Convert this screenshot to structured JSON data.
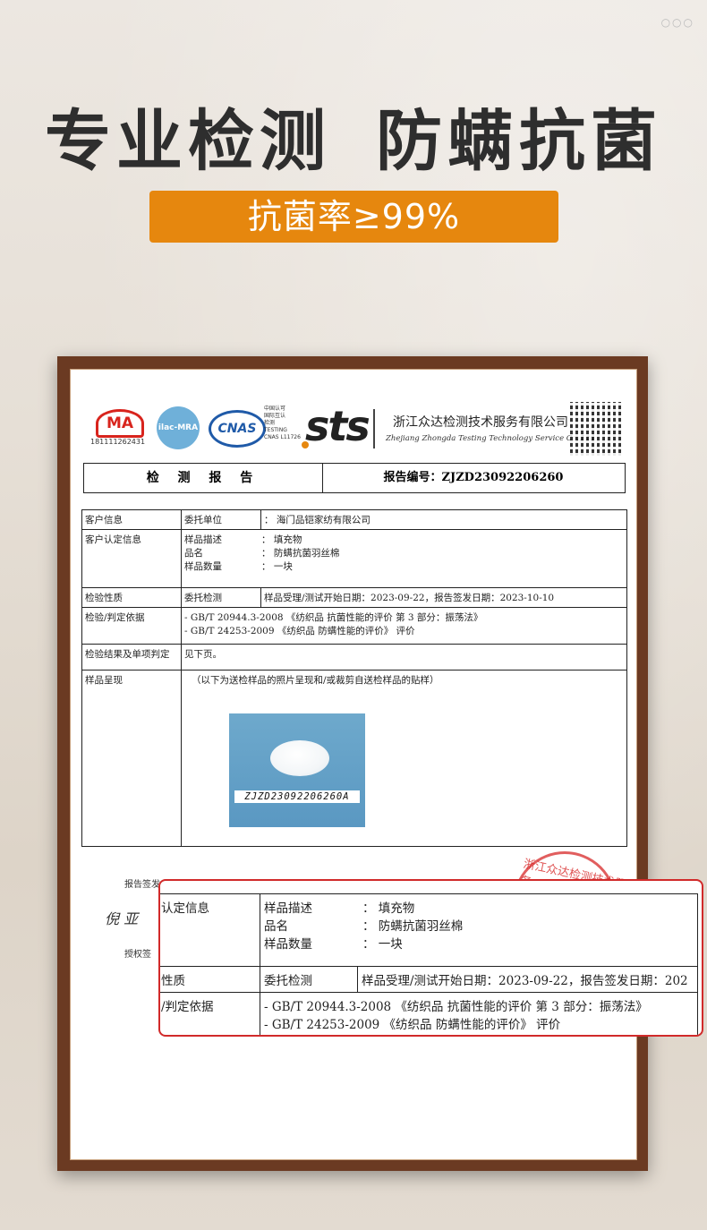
{
  "banner": {
    "headline_left": "专业检测",
    "headline_right": "防螨抗菌",
    "badge": "抗菌率≥99%"
  },
  "certificate": {
    "logos": {
      "cma": "MA",
      "cma_number": "181111262431",
      "ilac": "ilac-MRA",
      "cnas": "CNAS",
      "cnas_note": [
        "中国认可",
        "国际互认",
        "检测",
        "TESTING",
        "CNAS L11726"
      ],
      "sts": "sts"
    },
    "company_cn": "浙江众达检测技术服务有限公司",
    "company_en": "Zhejiang Zhongda Testing Technology Service Co.,Ltd",
    "report_title": "检 测 报 告",
    "report_number": "报告编号：ZJZD23092206260",
    "rows": {
      "client_label": "客户信息",
      "client_sub": "委托单位",
      "client_value": "： 海门品铠家纺有限公司",
      "confirm_label": "客户认定信息",
      "sample_desc_key": "样品描述",
      "sample_desc_val": "： 填充物",
      "name_key": "品名",
      "name_val": "： 防螨抗菌羽丝棉",
      "qty_key": "样品数量",
      "qty_val": "： 一块",
      "nature_label": "检验性质",
      "nature_sub": "委托检测",
      "nature_value": "样品受理/测试开始日期：2023-09-22，报告签发日期：2023-10-10",
      "basis_label": "检验/判定依据",
      "basis_1": "- GB/T 20944.3-2008 《纺织品 抗菌性能的评价 第 3 部分：振荡法》",
      "basis_2": "- GB/T 24253-2009 《纺织品 防螨性能的评价》 评价",
      "result_label": "检验结果及单项判定",
      "result_value": "见下页。",
      "sample_label": "样品呈现",
      "sample_note": "（以下为送检样品的照片呈现和/或裁剪自送检样品的贴样）",
      "photo_label": "ZJZD23092206260A"
    },
    "report_sign_label": "报告签发",
    "signature": "倪 亚",
    "auth_sign_label": "授权签",
    "stamp_text": "浙江众达检测技术服务"
  },
  "zoom": {
    "confirm_label": "认定信息",
    "sample_desc_key": "样品描述",
    "sample_desc_val": "： 填充物",
    "name_key": "品名",
    "name_val": "： 防螨抗菌羽丝棉",
    "qty_key": "样品数量",
    "qty_val": "： 一块",
    "nature_label": "性质",
    "nature_sub": "委托检测",
    "nature_value": "样品受理/测试开始日期：2023-09-22，报告签发日期：202",
    "basis_label": "/判定依据",
    "basis_1": "- GB/T 20944.3-2008 《纺织品 抗菌性能的评价 第 3 部分：振荡法》",
    "basis_2": "- GB/T 24253-2009 《纺织品 防螨性能的评价》 评价"
  },
  "colors": {
    "badge": "#e6870e",
    "frame": "#6b3a22",
    "callout_border": "#d12a2a"
  }
}
